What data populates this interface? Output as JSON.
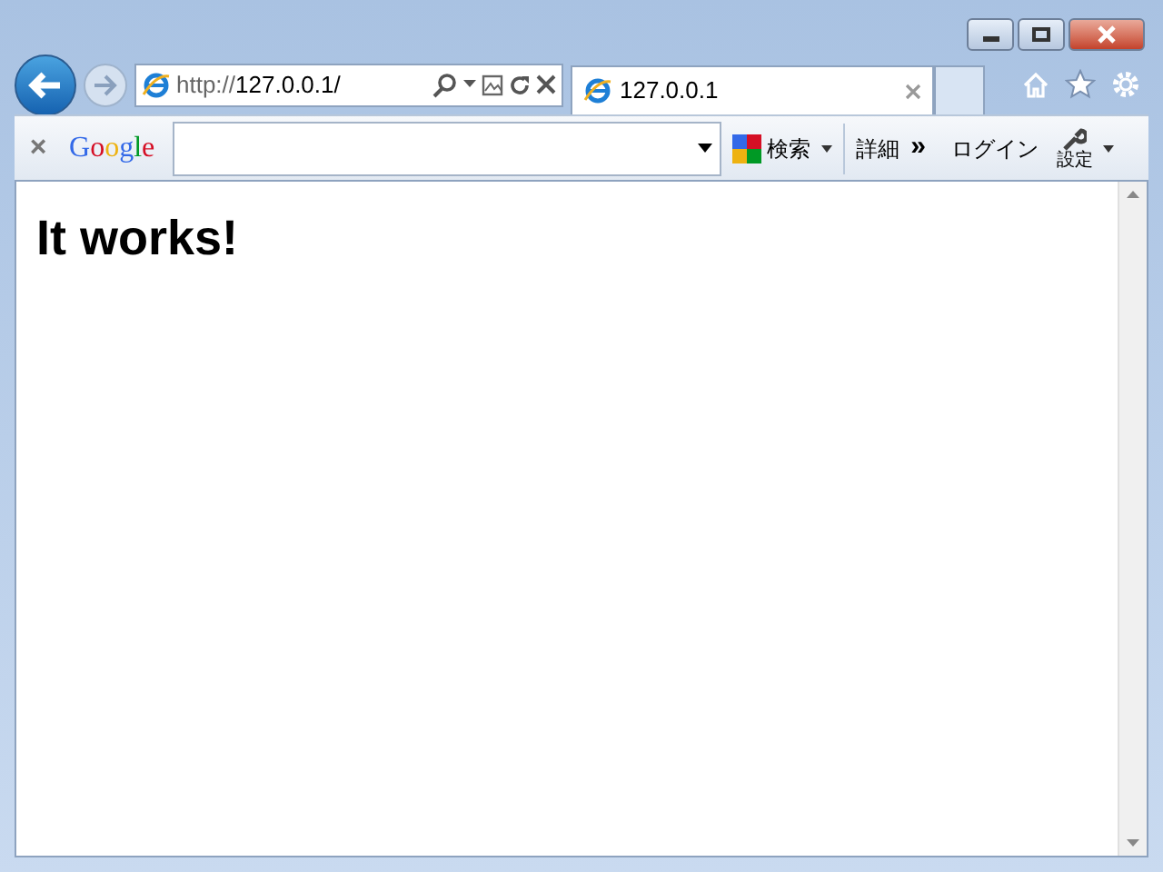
{
  "address_bar": {
    "scheme": "http://",
    "host": "127.0.0.1/"
  },
  "tabs": [
    {
      "label": "127.0.0.1",
      "selected": true
    }
  ],
  "google_toolbar": {
    "close": "×",
    "logo": "Google",
    "search_label": "検索",
    "more_label": "詳細",
    "more_glyph": "»",
    "login": "ログイン",
    "settings": "設定"
  },
  "page": {
    "heading": "It works!"
  }
}
